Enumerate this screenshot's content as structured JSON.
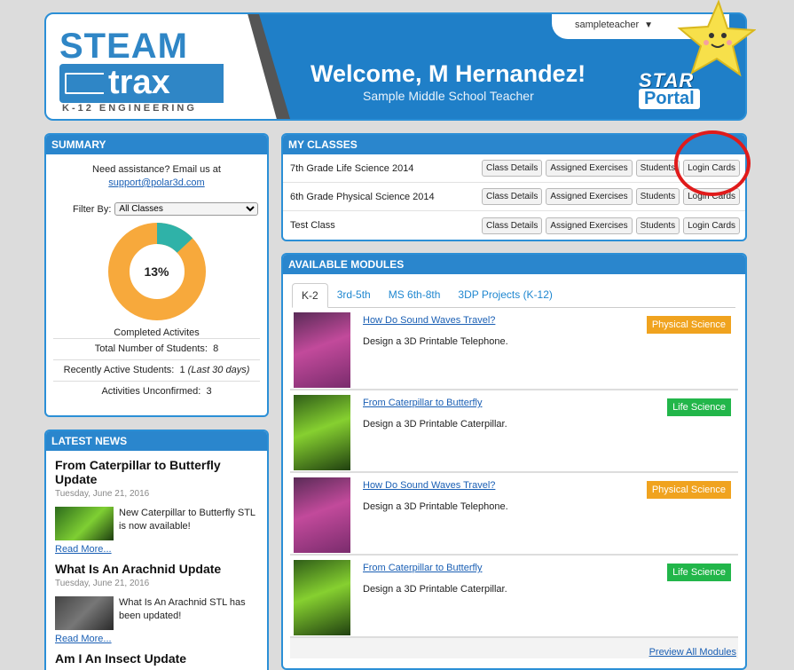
{
  "brand": {
    "logo_top": "STEAM",
    "logo_bottom": "trax",
    "logo_tagline": "K-12 ENGINEERING",
    "star_word": "STAR",
    "portal_word": "Portal"
  },
  "user_menu": {
    "username": "sampleteacher"
  },
  "header": {
    "welcome": "Welcome, M Hernandez!",
    "subtitle": "Sample Middle School Teacher"
  },
  "summary": {
    "title": "SUMMARY",
    "assist_text": "Need assistance? Email us at",
    "assist_email": "support@polar3d.com",
    "filter_label": "Filter By:",
    "filter_value": "All Classes",
    "completion_percent": "13%",
    "completion_fraction": 0.13,
    "completed_label": "Completed Activites",
    "stats": [
      {
        "label": "Total Number of Students:",
        "value": "8",
        "note": ""
      },
      {
        "label": "Recently Active Students:",
        "value": "1",
        "note": "(Last 30 days)"
      },
      {
        "label": "Activities Unconfirmed:",
        "value": "3",
        "note": ""
      }
    ],
    "colors": {
      "done": "#2fb2a8",
      "remaining": "#f7a93c"
    }
  },
  "news": {
    "title": "LATEST NEWS",
    "items": [
      {
        "title": "From Caterpillar to Butterfly Update",
        "date": "Tuesday, June 21, 2016",
        "text": "New Caterpillar to Butterfly STL is now available!",
        "link": "Read More..."
      },
      {
        "title": "What Is An Arachnid Update",
        "date": "Tuesday, June 21, 2016",
        "text": "What Is An Arachnid STL has been updated!",
        "link": "Read More..."
      },
      {
        "title": "Am I An Insect Update",
        "date": "",
        "text": "",
        "link": ""
      }
    ]
  },
  "classes": {
    "title": "MY CLASSES",
    "buttons": {
      "details": "Class Details",
      "exercises": "Assigned Exercises",
      "students": "Students",
      "login": "Login Cards"
    },
    "rows": [
      {
        "name": "7th Grade Life Science 2014"
      },
      {
        "name": "6th Grade Physical Science 2014"
      },
      {
        "name": "Test Class"
      }
    ]
  },
  "modules": {
    "title": "AVAILABLE MODULES",
    "tabs": [
      "K-2",
      "3rd-5th",
      "MS 6th-8th",
      "3DP Projects (K-12)"
    ],
    "active_tab": 0,
    "items": [
      {
        "title": "How Do Sound Waves Travel?",
        "desc": "Design a 3D Printable Telephone.",
        "tag": "Physical Science",
        "tag_type": "phys",
        "thumb": "pink"
      },
      {
        "title": "From Caterpillar to Butterfly",
        "desc": "Design a 3D Printable Caterpillar.",
        "tag": "Life Science",
        "tag_type": "life",
        "thumb": "green"
      },
      {
        "title": "How Do Sound Waves Travel?",
        "desc": "Design a 3D Printable Telephone.",
        "tag": "Physical Science",
        "tag_type": "phys",
        "thumb": "pink"
      },
      {
        "title": "From Caterpillar to Butterfly",
        "desc": "Design a 3D Printable Caterpillar.",
        "tag": "Life Science",
        "tag_type": "life",
        "thumb": "green"
      }
    ],
    "preview_link": "Preview All Modules"
  }
}
